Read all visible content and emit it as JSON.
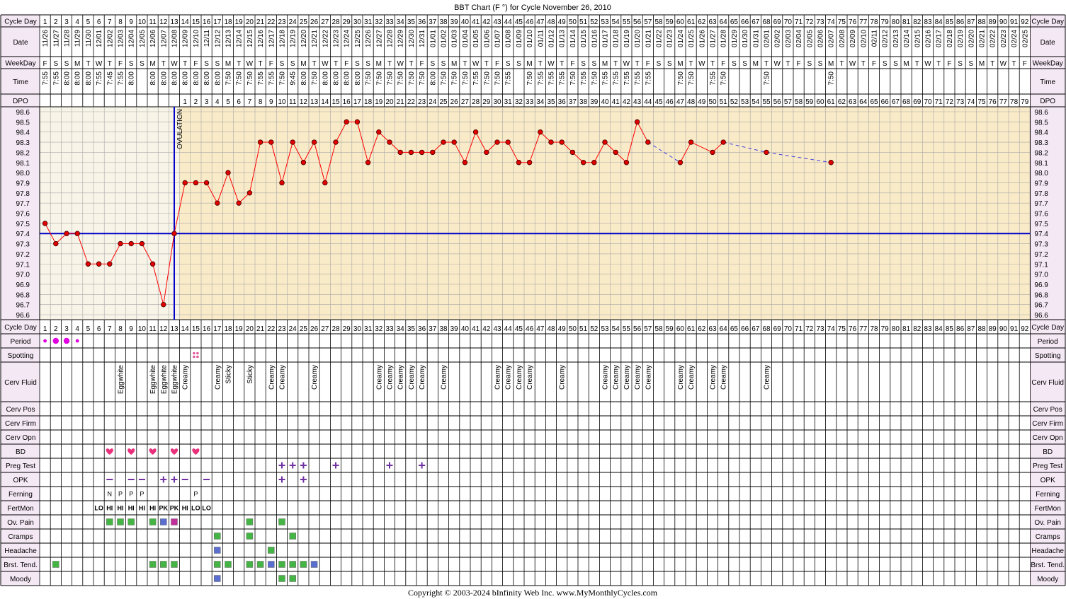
{
  "title": "BBT Chart (F °) for Cycle November 26, 2010",
  "footer": "Copyright © 2003-2024 bInfinity Web Inc.      www.MyMonthlyCycles.com",
  "colors": {
    "background": "#ffffff",
    "label_bg": "#f5e8f5",
    "pre_ovulation_bg": "#f8f5e8",
    "post_ovulation_bg": "#faebc8",
    "grid": "#a8a8a8",
    "line": "#ff0000",
    "dot": "#e00000",
    "coverline": "#0000c8",
    "projection": "#4040e0",
    "period": "#e000e0",
    "bd": "#e8307c",
    "symbol_purple": "#7030a0",
    "fertmon": "#006400",
    "green_box": "#44b444",
    "blue_box": "#5a6ed0",
    "magenta_box": "#c0309c",
    "spotting": "#e05a9c"
  },
  "labels": {
    "cycle_day": "Cycle Day",
    "date": "Date",
    "weekday": "WeekDay",
    "time": "Time",
    "dpo": "DPO",
    "ovulation": "OVULATION"
  },
  "symptom_labels": [
    "Period",
    "Spotting",
    "Cerv Fluid",
    "Cerv Pos",
    "Cerv Firm",
    "Cerv Opn",
    "BD",
    "Preg Test",
    "OPK",
    "Ferning",
    "FertMon",
    "Ov. Pain",
    "Cramps",
    "Headache",
    "Brst. Tend.",
    "Moody"
  ],
  "cycle_days": [
    1,
    2,
    3,
    4,
    5,
    6,
    7,
    8,
    9,
    10,
    11,
    12,
    13,
    14,
    15,
    16,
    17,
    18,
    19,
    20,
    21,
    22,
    23,
    24,
    25,
    26,
    27,
    28,
    29,
    30,
    31,
    32,
    33,
    34,
    35,
    36,
    37,
    38,
    39,
    40,
    41,
    42,
    43,
    44,
    45,
    46,
    47,
    48,
    49,
    50,
    51,
    52,
    53,
    54,
    55,
    56,
    57,
    58,
    59,
    60,
    61,
    62,
    63,
    64,
    65,
    66,
    67,
    68,
    69,
    70,
    71,
    72,
    73,
    74,
    75,
    76,
    77,
    78,
    79,
    80,
    81,
    82,
    83,
    84,
    85,
    86,
    87,
    88,
    89,
    90,
    91,
    92
  ],
  "dates": [
    "11/26",
    "11/27",
    "11/28",
    "11/29",
    "11/30",
    "12/01",
    "12/02",
    "12/03",
    "12/04",
    "12/05",
    "12/06",
    "12/07",
    "12/08",
    "12/09",
    "12/10",
    "12/11",
    "12/12",
    "12/13",
    "12/14",
    "12/15",
    "12/16",
    "12/17",
    "12/18",
    "12/19",
    "12/20",
    "12/21",
    "12/22",
    "12/23",
    "12/24",
    "12/25",
    "12/26",
    "12/27",
    "12/28",
    "12/29",
    "12/30",
    "12/31",
    "01/01",
    "01/02",
    "01/03",
    "01/04",
    "01/05",
    "01/06",
    "01/07",
    "01/08",
    "01/09",
    "01/10",
    "01/11",
    "01/12",
    "01/13",
    "01/14",
    "01/15",
    "01/16",
    "01/17",
    "01/18",
    "01/19",
    "01/20",
    "01/21",
    "01/22",
    "01/23",
    "01/24",
    "01/25",
    "01/26",
    "01/27",
    "01/28",
    "01/29",
    "01/30",
    "01/31",
    "02/01",
    "02/02",
    "02/03",
    "02/04",
    "02/05",
    "02/06",
    "02/07",
    "02/08",
    "02/09",
    "02/10",
    "02/11",
    "02/12",
    "02/13",
    "02/14",
    "02/15",
    "02/16",
    "02/17",
    "02/18",
    "02/19",
    "02/20",
    "02/21",
    "02/22",
    "02/23",
    "02/24",
    "02/25"
  ],
  "weekdays": [
    "F",
    "S",
    "S",
    "M",
    "T",
    "W",
    "T",
    "F",
    "S",
    "S",
    "M",
    "T",
    "W",
    "T",
    "F",
    "S",
    "S",
    "M",
    "T",
    "W",
    "T",
    "F",
    "S",
    "S",
    "M",
    "T",
    "W",
    "T",
    "F",
    "S",
    "S",
    "M",
    "T",
    "W",
    "T",
    "F",
    "S",
    "S",
    "M",
    "T",
    "W",
    "T",
    "F",
    "S",
    "S",
    "M",
    "T",
    "W",
    "T",
    "F",
    "S",
    "S",
    "M",
    "T",
    "W",
    "T",
    "F",
    "S",
    "S",
    "M",
    "T",
    "W",
    "T",
    "F",
    "S",
    "S",
    "M",
    "T",
    "W",
    "T",
    "F",
    "S",
    "S",
    "M",
    "T",
    "W",
    "T",
    "F",
    "S",
    "S",
    "M",
    "T",
    "W",
    "T",
    "F",
    "S",
    "S",
    "M",
    "T",
    "W",
    "T",
    "F"
  ],
  "times": [
    "7:55",
    "7:55",
    "8:00",
    "8:00",
    "8:00",
    "7:55",
    "7:45",
    "7:55",
    "8:00",
    "",
    "8:00",
    "8:00",
    "8:00",
    "8:00",
    "8:00",
    "8:00",
    "8:00",
    "7:50",
    "7:50",
    "7:50",
    "7:55",
    "7:55",
    "7:50",
    "9:45",
    "8:00",
    "7:50",
    "8:00",
    "8:00",
    "8:00",
    "8:00",
    "7:50",
    "7:50",
    "7:50",
    "7:50",
    "7:50",
    "7:50",
    "8:00",
    "7:50",
    "7:50",
    "7:50",
    "7:55",
    "7:50",
    "7:50",
    "7:55",
    "",
    "7:50",
    "7:55",
    "7:55",
    "7:55",
    "7:50",
    "7:55",
    "7:50",
    "7:55",
    "7:55",
    "7:55",
    "7:55",
    "7:55",
    "",
    "",
    "7:50",
    "7:50",
    "",
    "7:55",
    "7:50",
    "",
    "",
    "",
    "7:50",
    "",
    "",
    "",
    "",
    "",
    "7:50",
    "",
    "",
    "",
    "",
    "",
    "",
    "",
    "",
    "",
    "",
    "",
    "",
    "",
    "",
    "",
    "",
    "",
    ""
  ],
  "dpo": [
    "",
    "",
    "",
    "",
    "",
    "",
    "",
    "",
    "",
    "",
    "",
    "",
    "",
    "1",
    "2",
    "3",
    "4",
    "5",
    "6",
    "7",
    "8",
    "9",
    "10",
    "11",
    "12",
    "13",
    "14",
    "15",
    "16",
    "17",
    "18",
    "19",
    "20",
    "21",
    "22",
    "23",
    "24",
    "25",
    "26",
    "27",
    "28",
    "29",
    "30",
    "31",
    "32",
    "33",
    "34",
    "35",
    "36",
    "37",
    "38",
    "39",
    "40",
    "41",
    "42",
    "43",
    "44",
    "45",
    "46",
    "47",
    "48",
    "49",
    "50",
    "51",
    "52",
    "53",
    "54",
    "55",
    "56",
    "57",
    "58",
    "59",
    "60",
    "61",
    "62",
    "63",
    "64",
    "65",
    "66",
    "67",
    "68",
    "69",
    "70",
    "71",
    "72",
    "73",
    "74",
    "75",
    "76",
    "77",
    "78",
    "79"
  ],
  "chart_data": {
    "type": "line",
    "title": "BBT Chart (F °) for Cycle November 26, 2010",
    "xlabel": "Cycle Day",
    "ylabel": "",
    "ylim": [
      96.6,
      98.6
    ],
    "yticks": [
      "98.6",
      "98.5",
      "98.4",
      "98.3",
      "98.2",
      "98.1",
      "98.0",
      "97.9",
      "97.8",
      "97.7",
      "97.6",
      "97.5",
      "97.4",
      "97.3",
      "97.2",
      "97.1",
      "97.0",
      "96.9",
      "96.8",
      "96.7",
      "96.6"
    ],
    "grid": true,
    "coverline": 97.4,
    "ovulation_day": 13,
    "temps": [
      [
        1,
        97.5
      ],
      [
        2,
        97.3
      ],
      [
        3,
        97.4
      ],
      [
        4,
        97.4
      ],
      [
        5,
        97.1
      ],
      [
        6,
        97.1
      ],
      [
        7,
        97.1
      ],
      [
        8,
        97.3
      ],
      [
        9,
        97.3
      ],
      [
        10,
        97.3
      ],
      [
        11,
        97.1
      ],
      [
        12,
        96.7
      ],
      [
        13,
        97.4
      ],
      [
        14,
        97.9
      ],
      [
        15,
        97.9
      ],
      [
        16,
        97.9
      ],
      [
        17,
        97.7
      ],
      [
        18,
        98.0
      ],
      [
        19,
        97.7
      ],
      [
        20,
        97.8
      ],
      [
        21,
        98.3
      ],
      [
        22,
        98.3
      ],
      [
        23,
        97.9
      ],
      [
        24,
        98.3
      ],
      [
        25,
        98.1
      ],
      [
        26,
        98.3
      ],
      [
        27,
        97.9
      ],
      [
        28,
        98.3
      ],
      [
        29,
        98.5
      ],
      [
        30,
        98.5
      ],
      [
        31,
        98.1
      ],
      [
        32,
        98.4
      ],
      [
        33,
        98.3
      ],
      [
        34,
        98.2
      ],
      [
        35,
        98.2
      ],
      [
        36,
        98.2
      ],
      [
        37,
        98.2
      ],
      [
        38,
        98.3
      ],
      [
        39,
        98.3
      ],
      [
        40,
        98.1
      ],
      [
        41,
        98.4
      ],
      [
        42,
        98.2
      ],
      [
        43,
        98.3
      ],
      [
        44,
        98.3
      ],
      [
        45,
        98.1
      ],
      [
        46,
        98.1
      ],
      [
        47,
        98.4
      ],
      [
        48,
        98.3
      ],
      [
        49,
        98.3
      ],
      [
        50,
        98.2
      ],
      [
        51,
        98.1
      ],
      [
        52,
        98.1
      ],
      [
        53,
        98.3
      ],
      [
        54,
        98.2
      ],
      [
        55,
        98.1
      ],
      [
        56,
        98.5
      ],
      [
        57,
        98.3
      ],
      [
        60,
        98.1
      ],
      [
        61,
        98.3
      ],
      [
        63,
        98.2
      ],
      [
        64,
        98.3
      ],
      [
        68,
        98.2
      ],
      [
        74,
        98.1
      ]
    ],
    "dashed_gaps": [
      [
        57,
        60
      ],
      [
        64,
        68
      ],
      [
        68,
        74
      ]
    ]
  },
  "symptoms": {
    "period": [
      [
        1,
        "small"
      ],
      [
        2,
        "big"
      ],
      [
        3,
        "big"
      ],
      [
        4,
        "small"
      ]
    ],
    "spotting": [
      15
    ],
    "cerv_fluid": [
      [
        8,
        "Eggwhite"
      ],
      [
        11,
        "Eggwhite"
      ],
      [
        12,
        "Eggwhite"
      ],
      [
        13,
        "Eggwhite"
      ],
      [
        14,
        "Creamy"
      ],
      [
        17,
        "Creamy"
      ],
      [
        18,
        "Sticky"
      ],
      [
        20,
        "Sticky"
      ],
      [
        22,
        "Creamy"
      ],
      [
        23,
        "Creamy"
      ],
      [
        26,
        "Creamy"
      ],
      [
        32,
        "Creamy"
      ],
      [
        33,
        "Creamy"
      ],
      [
        34,
        "Creamy"
      ],
      [
        35,
        "Creamy"
      ],
      [
        36,
        "Creamy"
      ],
      [
        38,
        "Creamy"
      ],
      [
        43,
        "Creamy"
      ],
      [
        44,
        "Creamy"
      ],
      [
        45,
        "Creamy"
      ],
      [
        46,
        "Creamy"
      ],
      [
        49,
        "Creamy"
      ],
      [
        53,
        "Creamy"
      ],
      [
        54,
        "Creamy"
      ],
      [
        55,
        "Creamy"
      ],
      [
        56,
        "Creamy"
      ],
      [
        57,
        "Creamy"
      ],
      [
        60,
        "Creamy"
      ],
      [
        61,
        "Creamy"
      ],
      [
        63,
        "Creamy"
      ],
      [
        64,
        "Creamy"
      ],
      [
        68,
        "Creamy"
      ]
    ],
    "bd": [
      7,
      9,
      11,
      13,
      15
    ],
    "preg_test": [
      23,
      24,
      25,
      28,
      33,
      36
    ],
    "opk": [
      [
        7,
        "−"
      ],
      [
        9,
        "−"
      ],
      [
        10,
        "−"
      ],
      [
        12,
        "+"
      ],
      [
        13,
        "+"
      ],
      [
        14,
        "−"
      ],
      [
        16,
        "−"
      ],
      [
        23,
        "+"
      ],
      [
        25,
        "+"
      ]
    ],
    "ferning": [
      [
        7,
        "N"
      ],
      [
        8,
        "P"
      ],
      [
        9,
        "P"
      ],
      [
        10,
        "P"
      ],
      [
        15,
        "P"
      ]
    ],
    "fertmon": [
      [
        6,
        "LO"
      ],
      [
        7,
        "HI"
      ],
      [
        8,
        "HI"
      ],
      [
        9,
        "HI"
      ],
      [
        10,
        "HI"
      ],
      [
        11,
        "HI"
      ],
      [
        12,
        "PK"
      ],
      [
        13,
        "PK"
      ],
      [
        14,
        "HI"
      ],
      [
        15,
        "LO"
      ],
      [
        16,
        "LO"
      ]
    ],
    "ov_pain": [
      [
        7,
        "g"
      ],
      [
        8,
        "g"
      ],
      [
        9,
        "g"
      ],
      [
        11,
        "g"
      ],
      [
        12,
        "b"
      ],
      [
        13,
        "m"
      ],
      [
        20,
        "g"
      ],
      [
        23,
        "g"
      ]
    ],
    "cramps": [
      [
        17,
        "g"
      ],
      [
        20,
        "g"
      ],
      [
        24,
        "g"
      ]
    ],
    "headache": [
      [
        17,
        "b"
      ],
      [
        22,
        "g"
      ]
    ],
    "brst_tend": [
      [
        2,
        "g"
      ],
      [
        11,
        "g"
      ],
      [
        12,
        "g"
      ],
      [
        13,
        "g"
      ],
      [
        17,
        "g"
      ],
      [
        18,
        "g"
      ],
      [
        20,
        "g"
      ],
      [
        21,
        "g"
      ],
      [
        22,
        "b"
      ],
      [
        23,
        "g"
      ],
      [
        24,
        "g"
      ],
      [
        25,
        "g"
      ],
      [
        26,
        "b"
      ]
    ],
    "moody": [
      [
        17,
        "b"
      ],
      [
        23,
        "g"
      ],
      [
        24,
        "g"
      ]
    ]
  }
}
